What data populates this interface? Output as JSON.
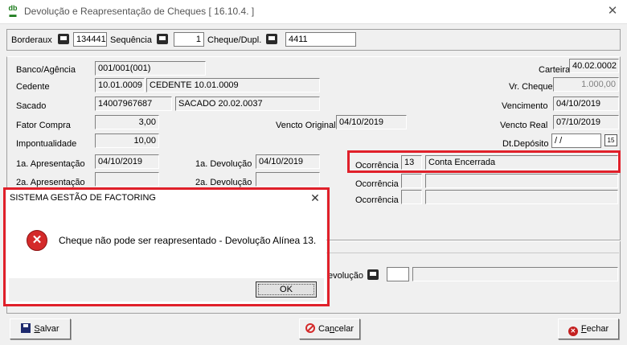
{
  "window": {
    "title": "Devolução e Reapresentação de Cheques [ 16.10.4. ]",
    "app_icon": "db-app-icon"
  },
  "search_bar": {
    "borderaux_label": "Borderaux",
    "borderaux_value": "134441",
    "sequencia_label": "Sequência",
    "sequencia_value": "1",
    "cheque_label": "Cheque/Dupl.",
    "cheque_value": "4411"
  },
  "form": {
    "banco_label": "Banco/Agência",
    "banco_value": "001/001(001)",
    "cedente_label": "Cedente",
    "cedente_code": "10.01.0009",
    "cedente_name": "CEDENTE 10.01.0009",
    "sacado_label": "Sacado",
    "sacado_code": "14007967687",
    "sacado_name": "SACADO 20.02.0037",
    "fator_label": "Fator Compra",
    "fator_value": "3,00",
    "impont_label": "Impontualidade",
    "impont_value": "10,00",
    "apres1_label": "1a. Apresentação",
    "apres1_value": "04/10/2019",
    "apres2_label": "2a. Apresentação",
    "devol1_label": "1a. Devolução",
    "devol1_value": "04/10/2019",
    "devol2_label": "2a. Devolução",
    "vencto_original_label": "Vencto Original",
    "vencto_original_value": "04/10/2019",
    "carteira_label": "Carteira",
    "carteira_value": "40.02.0002",
    "vr_cheque_label": "Vr. Cheque",
    "vr_cheque_value": "1.000,00",
    "vencimento_label": "Vencimento",
    "vencimento_value": "04/10/2019",
    "vencto_real_label": "Vencto Real",
    "vencto_real_value": "07/10/2019",
    "dt_deposito_label": "Dt.Depósito",
    "dt_deposito_value": " / /",
    "ocorrencia_label": "Ocorrência",
    "ocorrencia1_code": "13",
    "ocorrencia1_desc": "Conta Encerrada",
    "ocorrencia2_label": "Ocorrência",
    "ocorrencia3_label": "Ocorrência",
    "devolucao_label": "evolução"
  },
  "dialog": {
    "title": "SISTEMA GESTÃO DE FACTORING",
    "message": "Cheque não pode ser reapresentado - Devolução Alínea 13.",
    "ok_label": "OK"
  },
  "buttons": {
    "save": "Salvar",
    "save_underline": "S",
    "save_rest": "alvar",
    "cancel_pre": "Ca",
    "cancel_underline": "n",
    "cancel_rest": "celar",
    "close_underline": "F",
    "close_rest": "echar"
  },
  "colors": {
    "highlight_red": "#e0202a",
    "error_icon": "#d42a2a"
  }
}
